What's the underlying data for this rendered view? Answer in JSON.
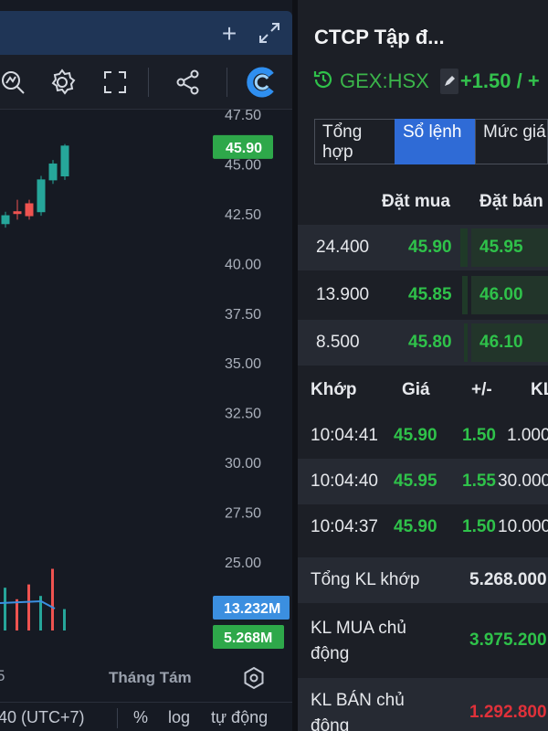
{
  "chart": {
    "price_axis": [
      "47.50",
      "45.00",
      "42.50",
      "40.00",
      "37.50",
      "35.00",
      "32.50",
      "30.00",
      "27.50",
      "25.00"
    ],
    "last_price_label": "45.90",
    "volume_total_label": "13.232M",
    "volume_last_label": "5.268M",
    "month_label": "Tháng Tám",
    "left_edge_label": "5",
    "timezone_label": "40 (UTC+7)",
    "percent_label": "%",
    "log_label": "log",
    "auto_label": "tự động",
    "colors": {
      "up": "#26a69a",
      "down": "#ef5350",
      "price_badge": "#2ea84a",
      "vol_badge": "#3b8fe0"
    }
  },
  "chart_data": {
    "type": "candlestick",
    "candles": [
      {
        "open": 42.0,
        "high": 42.6,
        "low": 41.8,
        "close": 42.4,
        "dir": "up"
      },
      {
        "open": 42.6,
        "high": 43.2,
        "low": 42.2,
        "close": 42.6,
        "dir": "down"
      },
      {
        "open": 43.0,
        "high": 43.2,
        "low": 42.2,
        "close": 42.4,
        "dir": "down"
      },
      {
        "open": 42.6,
        "high": 44.4,
        "low": 42.4,
        "close": 44.2,
        "dir": "up"
      },
      {
        "open": 44.2,
        "high": 45.2,
        "low": 44.0,
        "close": 45.0,
        "dir": "up"
      },
      {
        "open": 44.4,
        "high": 46.0,
        "low": 44.2,
        "close": 45.9,
        "dir": "up"
      }
    ],
    "volumes": [
      {
        "value": 5.2,
        "dir": "up"
      },
      {
        "value": 3.8,
        "dir": "down"
      },
      {
        "value": 5.6,
        "dir": "down"
      },
      {
        "value": 4.2,
        "dir": "up"
      },
      {
        "value": 7.5,
        "dir": "down"
      },
      {
        "value": 2.6,
        "dir": "up"
      }
    ],
    "ylim": [
      22.5,
      48.5
    ]
  },
  "header": {
    "company_name": "CTCP Tập đ...",
    "ticker": "GEX:HSX",
    "change": "+1.50 / +"
  },
  "tabs": [
    {
      "label": "Tổng hợp",
      "active": false
    },
    {
      "label": "Sổ lệnh",
      "active": true
    },
    {
      "label": "Mức giá",
      "active": false
    }
  ],
  "orderbook": {
    "headers": {
      "bid": "Đặt mua",
      "ask": "Đặt bán"
    },
    "rows": [
      {
        "volume": "24.400",
        "bid": "45.90",
        "ask": "45.95"
      },
      {
        "volume": "13.900",
        "bid": "45.85",
        "ask": "46.00"
      },
      {
        "volume": "8.500",
        "bid": "45.80",
        "ask": "46.10"
      }
    ]
  },
  "trades": {
    "headers": {
      "time": "Khớp",
      "price": "Giá",
      "change": "+/-",
      "volume": "KL"
    },
    "rows": [
      {
        "time": "10:04:41",
        "price": "45.90",
        "change": "1.50",
        "volume": "1.000"
      },
      {
        "time": "10:04:40",
        "price": "45.95",
        "change": "1.55",
        "volume": "30.000"
      },
      {
        "time": "10:04:37",
        "price": "45.90",
        "change": "1.50",
        "volume": "10.000"
      }
    ]
  },
  "summary": {
    "total_label": "Tổng KL khớp",
    "total_value": "5.268.000",
    "buy_label": "KL MUA chủ động",
    "buy_value": "3.975.200",
    "sell_label": "KL BÁN chủ động",
    "sell_value": "1.292.800"
  }
}
